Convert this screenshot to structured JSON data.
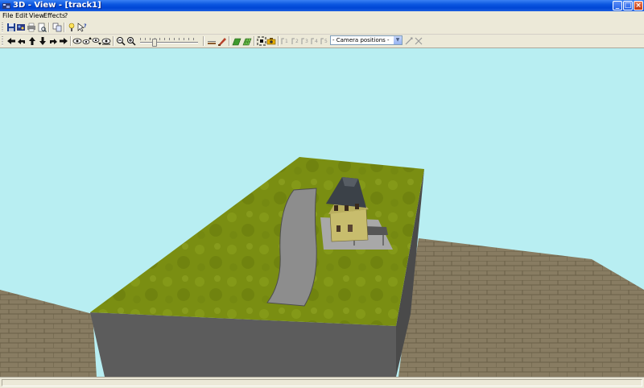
{
  "window": {
    "title": "3D - View - [track1]",
    "controls": {
      "minimize": "_",
      "maximize": "□",
      "close": "×"
    }
  },
  "menu": {
    "items": [
      "File",
      "Edit",
      "View",
      "Effects",
      "?"
    ]
  },
  "toolbar1": {
    "icons": [
      "save-icon",
      "export-icon",
      "print-icon",
      "print-preview-icon",
      "copy-icon",
      "info-icon",
      "help-pointer-icon"
    ]
  },
  "toolbar2": {
    "nav_icons": [
      "arrow-left-icon",
      "rotate-left-icon",
      "arrow-up-icon",
      "arrow-down-icon",
      "rotate-right-icon",
      "arrow-right-icon"
    ],
    "view_icons": [
      "eye-icon",
      "eye-up-icon",
      "eye-down-icon",
      "eye-reset-icon"
    ],
    "zoom_icons": [
      "zoom-out-icon",
      "zoom-in-icon"
    ],
    "zoom_level": 0.23,
    "tool_icons": [
      "track-icon",
      "terrain-brush-icon",
      "grass-icon",
      "grid-icon",
      "fit-view-icon",
      "camera-icon"
    ],
    "camera_marker_icons": [
      "camera-pos-1-icon",
      "camera-pos-2-icon",
      "camera-pos-3-icon",
      "camera-pos-4-icon",
      "camera-pos-5-icon"
    ],
    "camera_select_value": "- Camera positions -",
    "camera_action_icons": [
      "camera-set-icon",
      "camera-clear-icon"
    ]
  },
  "viewport": {
    "sky_color": "#b8eef2",
    "grass_color": "#7a8e12",
    "floor_color": "#867a60"
  }
}
